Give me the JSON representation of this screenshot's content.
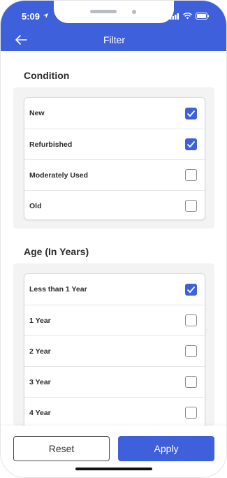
{
  "status": {
    "time": "5:09"
  },
  "header": {
    "title": "Filter"
  },
  "sections": [
    {
      "title": "Condition",
      "options": [
        {
          "label": "New",
          "checked": true
        },
        {
          "label": "Refurbished",
          "checked": true
        },
        {
          "label": "Moderately Used",
          "checked": false
        },
        {
          "label": "Old",
          "checked": false
        }
      ]
    },
    {
      "title": "Age (In Years)",
      "options": [
        {
          "label": "Less than 1 Year",
          "checked": true
        },
        {
          "label": "1 Year",
          "checked": false
        },
        {
          "label": "2 Year",
          "checked": false
        },
        {
          "label": "3 Year",
          "checked": false
        },
        {
          "label": "4 Year",
          "checked": false
        }
      ]
    }
  ],
  "footer": {
    "reset_label": "Reset",
    "apply_label": "Apply"
  },
  "colors": {
    "accent": "#3f60db"
  },
  "icons": {
    "back": "arrow-left-icon",
    "check": "checkmark-icon"
  }
}
